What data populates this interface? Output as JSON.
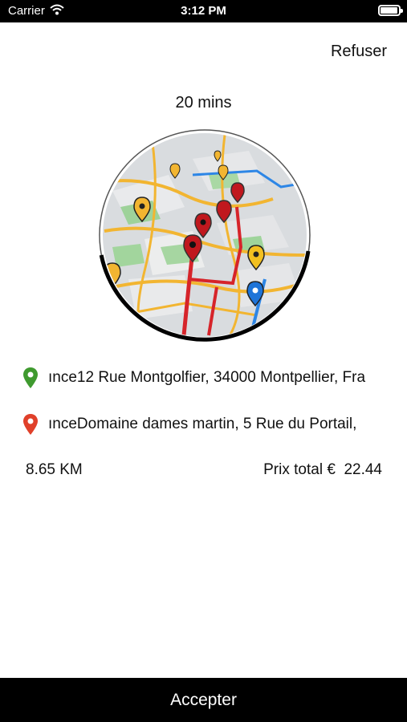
{
  "status_bar": {
    "carrier": "Carrier",
    "time": "3:12 PM",
    "battery_level": 0.95
  },
  "header": {
    "refuse_label": "Refuser"
  },
  "trip": {
    "eta": "20 mins",
    "pickup_address": "ınce12 Rue Montgolfier, 34000 Montpellier, Fra",
    "dropoff_address": "ınceDomaine dames martin, 5 Rue du Portail,",
    "distance": "8.65 KM",
    "price_label": "Prix total €",
    "price_value": "22.44"
  },
  "colors": {
    "pickup_pin": "#3f9a2f",
    "dropoff_pin": "#e0402a",
    "accent": "#000000"
  },
  "footer": {
    "accept_label": "Accepter"
  }
}
